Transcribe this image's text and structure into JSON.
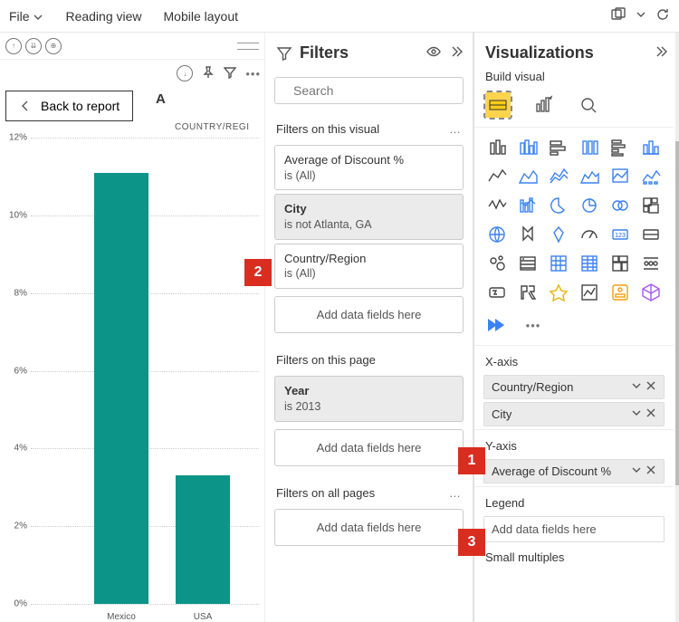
{
  "menu": {
    "file": "File",
    "reading_view": "Reading view",
    "mobile_layout": "Mobile layout"
  },
  "back_label": "Back to report",
  "chart_title_fragment": "A",
  "axis_label_fragment": "COUNTRY/REGI",
  "chart_data": {
    "type": "bar",
    "title": "Average of Discount % by Country/Region",
    "categories": [
      "Mexico",
      "USA"
    ],
    "values": [
      11.1,
      3.3
    ],
    "ylabel": "%",
    "xlabel": "Country/Region",
    "ylim": [
      0,
      12
    ],
    "y_ticks": [
      0,
      2,
      4,
      6,
      8,
      10,
      12
    ],
    "bar_color": "#0d9488"
  },
  "filters": {
    "title": "Filters",
    "search_placeholder": "Search",
    "sections": {
      "visual": {
        "title": "Filters on this visual",
        "cards": [
          {
            "title": "Average of Discount %",
            "sub": "is (All)",
            "selected": false
          },
          {
            "title": "City",
            "sub": "is not Atlanta, GA",
            "selected": true
          },
          {
            "title": "Country/Region",
            "sub": "is (All)",
            "selected": false
          }
        ],
        "drop": "Add data fields here"
      },
      "page": {
        "title": "Filters on this page",
        "cards": [
          {
            "title": "Year",
            "sub": "is 2013",
            "selected": true
          }
        ],
        "drop": "Add data fields here"
      },
      "all": {
        "title": "Filters on all pages",
        "drop": "Add data fields here"
      }
    }
  },
  "viz": {
    "title": "Visualizations",
    "build_label": "Build visual",
    "wells": {
      "xaxis": {
        "label": "X-axis",
        "items": [
          "Country/Region",
          "City"
        ]
      },
      "yaxis": {
        "label": "Y-axis",
        "items": [
          "Average of Discount %"
        ]
      },
      "legend": {
        "label": "Legend",
        "drop": "Add data fields here"
      },
      "small_multiples": {
        "label": "Small multiples"
      }
    }
  },
  "callouts": {
    "c1": "1",
    "c2": "2",
    "c3": "3"
  }
}
